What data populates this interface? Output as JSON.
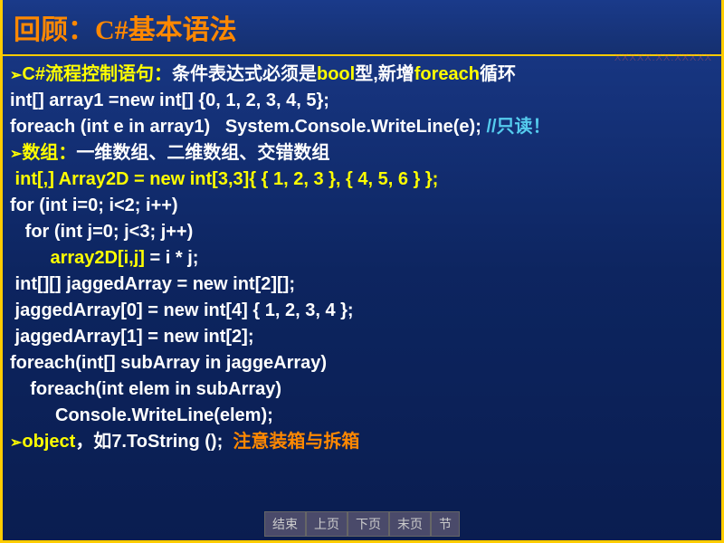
{
  "title": "回顾：C#基本语法",
  "watermark": "XXXXX.XX.XXXXX",
  "lines": {
    "l1a": "C#流程控制语句：",
    "l1b": "条件表达式必须是",
    "l1c": "bool",
    "l1d": "型,新增",
    "l1e": "foreach",
    "l1f": "循环",
    "l2": "int[] array1 =new int[] {0, 1, 2, 3, 4, 5};",
    "l3a": "foreach (int e in array1)   System.Console.WriteLine(e); ",
    "l3b": "//只读！",
    "l4a": "数组：",
    "l4b": "一维数组、二维数组、交错数组",
    "l5": " int[,] Array2D = new int[3,3]{ { 1, 2, 3 }, { 4, 5, 6 } };",
    "l6": "for (int i=0; i<2; i++)",
    "l7": "   for (int j=0; j<3; j++)",
    "l8a": "        ",
    "l8b": "array2D[i,j]",
    "l8c": " = i * j;",
    "l9": " int[][] jaggedArray = new int[2][];",
    "l10": " jaggedArray[0] = new int[4] { 1, 2, 3, 4 };",
    "l11": " jaggedArray[1] = new int[2];",
    "l12": "foreach(int[] subArray in jaggeArray)",
    "l13": "    foreach(int elem in subArray)",
    "l14": "         Console.WriteLine(elem);",
    "l15a": "object",
    "l15b": "，如",
    "l15c": "7.ToString ();",
    "l15d": "  注意装箱与拆箱"
  },
  "nav": {
    "end": "结束",
    "prev": "上页",
    "next": "下页",
    "last": "末页",
    "section": "节"
  }
}
